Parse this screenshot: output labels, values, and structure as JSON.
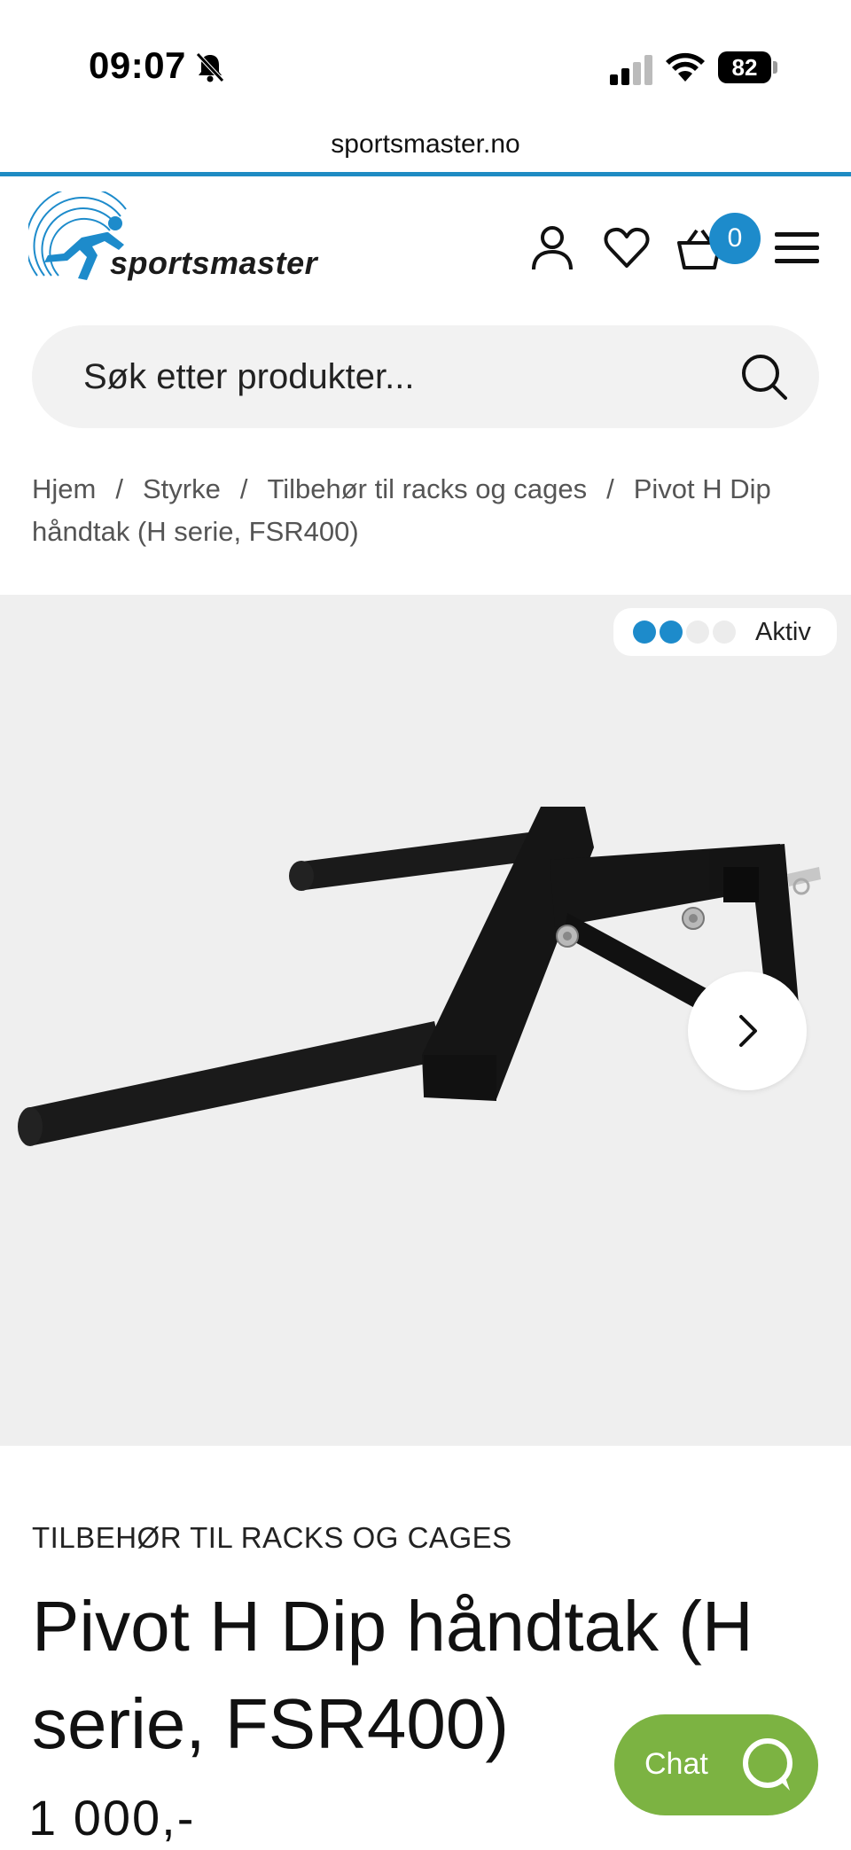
{
  "status_bar": {
    "time": "09:07",
    "battery": "82"
  },
  "browser": {
    "url": "sportsmaster.no"
  },
  "header": {
    "logo_text": "sportsmaster",
    "cart_count": "0"
  },
  "search": {
    "placeholder": "Søk etter produkter..."
  },
  "breadcrumb": {
    "items": [
      "Hjem",
      "Styrke",
      "Tilbehør til racks og cages",
      "Pivot H Dip håndtak (H serie, FSR400)"
    ],
    "separator": "/"
  },
  "gallery": {
    "activity_label": "Aktiv",
    "activity_level": 2,
    "activity_max": 4
  },
  "product": {
    "category": "TILBEHØR TIL RACKS OG CAGES",
    "title": "Pivot H Dip håndtak (H serie, FSR400)",
    "price": "1 000,-"
  },
  "chat": {
    "label": "Chat"
  },
  "colors": {
    "brand_blue": "#1d8bcb",
    "chat_green": "#7cb342",
    "gallery_bg": "#efefef"
  }
}
